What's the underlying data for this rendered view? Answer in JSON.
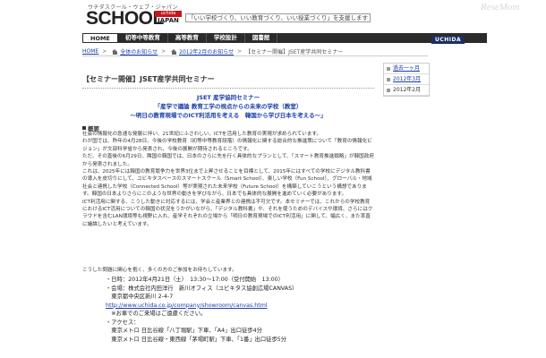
{
  "header": {
    "logo_sub": "ウチダスクール・ウェブ・ジャパン",
    "logo_main": "SCHOOL",
    "logo_url": "uchida",
    "logo_japan": "JAPAN",
    "tagline": "「いい学校づくり、いい教育づくり、いい授業づくり」を支援します",
    "watermark": "ReseMom",
    "brand_badge": "UCHIDA"
  },
  "nav": {
    "items": [
      {
        "label": "HOME",
        "active": true
      },
      {
        "label": "初等中等教育",
        "active": false
      },
      {
        "label": "高等教育",
        "active": false
      },
      {
        "label": "学校設計",
        "active": false
      },
      {
        "label": "図書館",
        "active": false
      }
    ]
  },
  "breadcrumb": {
    "home": "HOME",
    "news": "全体のお知らせ",
    "month": "2012年2月のお知らせ",
    "current": "【セミナー開催】JSET産学共同セミナー"
  },
  "sidebar": {
    "items": [
      {
        "label": "過去一ヶ月",
        "link": true
      },
      {
        "label": "2012年3月",
        "link": true
      },
      {
        "label": "2012年2月",
        "link": false
      }
    ]
  },
  "article": {
    "title": "【セミナー開催】JSET産学共同セミナー",
    "center_line1": "JSET 産学協同セミナー",
    "center_line2": "「産学で議論 教育工学の視点からの未来の学校（教室）",
    "center_line3": "～明日の教育現場でのICT利活用を考える　韓国から学び日本を考える～」",
    "section_heading": "概要",
    "paragraphs": [
      "社会の情報化の急速な発展に伴い、21世紀にふさわしい、ICTを活用した教育の実現が求められています。",
      "わが国では、昨年の4月28日、今後の学校教育（初等中等教育段階）の情報化に関する総合的な推進策について「教育の情報化ビジョン」が文部科学省から発表され、今後の展開が期待されるところです。",
      "ただ、その直後の6月29日、隣国の韓国では、日本のさらに先を行く具体的なプランとして、「スマート教育推進戦略」が韓国政府から発表されました。",
      "これは、2025年には韓国の教育競争力を世界3位まで上昇させることを目標として、2015年にはすべての学校にデジタル教科書の導入を皮切りにして、ユビキタスベースのスマートスクール（Smart School）、楽しい学校（Fun School）、グローバル・地域社会と連携した学校（Connected School）等が実現された未来学校（Future School）を構築していこうという構想であります。韓国の日本よりさらにこのような世界の動きを学びながら、日本でも具体的な展開を進めていく必要があります。",
      "ICT利活用に関する、こうした動きに対応するには、学会と産業界との連携は不可欠です。本セミナーでは、これからの学校教育におけるICT活用についての韓国の状況をうかがいながら、「デジタル教科書」や、それを使うためのデバイスや環境、さらにはクラウドを含むLAN環境等も視野に入れ、産学それぞれの立場から「明日の教育現場でのICT利活用」に関して、幅広く、また率直に議論したいと考えています。"
    ],
    "closing": "こうした問題に関心を抱く、多くの方のご参加をお待ちしています。",
    "details": [
      "・日時：2012年4月21日（土）　13:30～17:00（受付開始　13:00）",
      "・会場：株式会社内田洋行　新川オフィス（ユビキタス協創広場CANVAS）",
      "　東京都中央区新川 2-4-7",
      "http://www.uchida.co.jp/company/showroom/canvas.html",
      "　※お車でのご来場はご遠慮ください。",
      "・アクセス：",
      "　東京メトロ 日比谷線「八丁堀駅」下車、「A4」出口徒歩4分",
      "　東京メトロ 日比谷線・東西線「茅場町駅」下車、「1番」出口徒歩5分"
    ]
  }
}
